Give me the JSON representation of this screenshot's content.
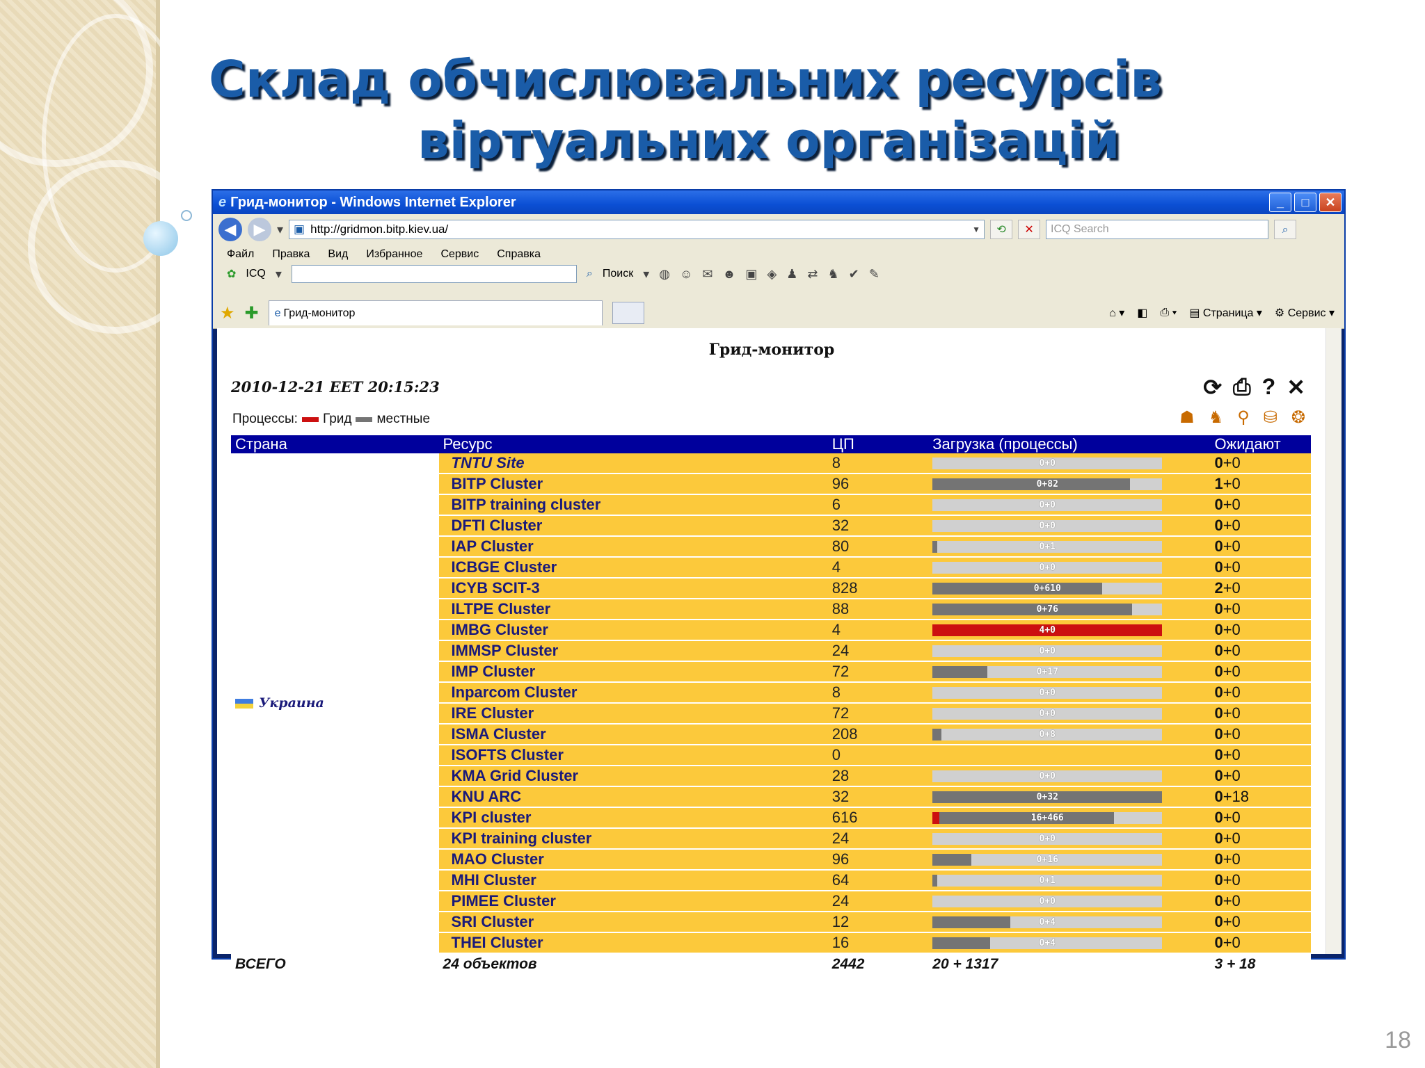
{
  "slide": {
    "title_line1": "Склад обчислювальних ресурсів",
    "title_line2": "віртуальних організацій",
    "page_number": "18"
  },
  "window": {
    "title": "Грид-монитор - Windows Internet Explorer",
    "address": "http://gridmon.bitp.kiev.ua/",
    "search_placeholder": "ICQ Search",
    "menu": [
      "Файл",
      "Правка",
      "Вид",
      "Избранное",
      "Сервис",
      "Справка"
    ],
    "toolbar_icq": "ICQ",
    "toolbar_search": "Поиск",
    "tab_label": "Грид-монитор",
    "page_menu": "Страница",
    "service_menu": "Сервис"
  },
  "page": {
    "title": "Грид-монитор",
    "datetime": "2010-12-21 EET 20:15:23",
    "legend_label": "Процессы:",
    "legend_grid": "Грид",
    "legend_local": "местные",
    "colors": {
      "grid": "#cc1010",
      "local": "#747474",
      "row": "#fcc93b",
      "header": "#00009c"
    }
  },
  "table": {
    "headers": [
      "Страна",
      "Ресурс",
      "ЦП",
      "Загрузка (процессы)",
      "Ожидают"
    ],
    "country": "Украина",
    "rows": [
      {
        "name": "TNTU Site",
        "italic": true,
        "cpu": "8",
        "load": "0+0",
        "grid_frac": 0,
        "local_frac": 0,
        "wait_a": "0",
        "wait_b": "+0"
      },
      {
        "name": "BITP Cluster",
        "cpu": "96",
        "load": "0+82",
        "grid_frac": 0,
        "local_frac": 0.86,
        "wait_a": "1",
        "wait_b": "+0"
      },
      {
        "name": "BITP training cluster",
        "cpu": "6",
        "load": "0+0",
        "grid_frac": 0,
        "local_frac": 0,
        "wait_a": "0",
        "wait_b": "+0"
      },
      {
        "name": "DFTI Cluster",
        "cpu": "32",
        "load": "0+0",
        "grid_frac": 0,
        "local_frac": 0,
        "wait_a": "0",
        "wait_b": "+0"
      },
      {
        "name": "IAP Cluster",
        "cpu": "80",
        "load": "0+1",
        "grid_frac": 0,
        "local_frac": 0.02,
        "wait_a": "0",
        "wait_b": "+0"
      },
      {
        "name": "ICBGE Cluster",
        "cpu": "4",
        "load": "0+0",
        "grid_frac": 0,
        "local_frac": 0,
        "wait_a": "0",
        "wait_b": "+0"
      },
      {
        "name": "ICYB SCIT-3",
        "cpu": "828",
        "load": "0+610",
        "grid_frac": 0,
        "local_frac": 0.74,
        "wait_a": "2",
        "wait_b": "+0"
      },
      {
        "name": "ILTPE Cluster",
        "cpu": "88",
        "load": "0+76",
        "grid_frac": 0,
        "local_frac": 0.87,
        "wait_a": "0",
        "wait_b": "+0"
      },
      {
        "name": "IMBG Cluster",
        "cpu": "4",
        "load": "4+0",
        "grid_frac": 1,
        "local_frac": 0,
        "wait_a": "0",
        "wait_b": "+0"
      },
      {
        "name": "IMMSP Cluster",
        "cpu": "24",
        "load": "0+0",
        "grid_frac": 0,
        "local_frac": 0,
        "wait_a": "0",
        "wait_b": "+0"
      },
      {
        "name": "IMP Cluster",
        "cpu": "72",
        "load": "0+17",
        "grid_frac": 0,
        "local_frac": 0.24,
        "wait_a": "0",
        "wait_b": "+0"
      },
      {
        "name": "Inparcom Cluster",
        "cpu": "8",
        "load": "0+0",
        "grid_frac": 0,
        "local_frac": 0,
        "wait_a": "0",
        "wait_b": "+0"
      },
      {
        "name": "IRE Cluster",
        "cpu": "72",
        "load": "0+0",
        "grid_frac": 0,
        "local_frac": 0,
        "wait_a": "0",
        "wait_b": "+0"
      },
      {
        "name": "ISMA Cluster",
        "cpu": "208",
        "load": "0+8",
        "grid_frac": 0,
        "local_frac": 0.04,
        "wait_a": "0",
        "wait_b": "+0"
      },
      {
        "name": "ISOFTS Cluster",
        "cpu": "0",
        "load": "",
        "grid_frac": 0,
        "local_frac": 0,
        "nobar": true,
        "wait_a": "0",
        "wait_b": "+0"
      },
      {
        "name": "KMA Grid Cluster",
        "cpu": "28",
        "load": "0+0",
        "grid_frac": 0,
        "local_frac": 0,
        "wait_a": "0",
        "wait_b": "+0"
      },
      {
        "name": "KNU ARC",
        "cpu": "32",
        "load": "0+32",
        "grid_frac": 0,
        "local_frac": 1,
        "wait_a": "0",
        "wait_b": "+18"
      },
      {
        "name": "KPI cluster",
        "cpu": "616",
        "load": "16+466",
        "grid_frac": 0.03,
        "local_frac": 0.76,
        "wait_a": "0",
        "wait_b": "+0"
      },
      {
        "name": "KPI training cluster",
        "cpu": "24",
        "load": "0+0",
        "grid_frac": 0,
        "local_frac": 0,
        "wait_a": "0",
        "wait_b": "+0"
      },
      {
        "name": "MAO Cluster",
        "cpu": "96",
        "load": "0+16",
        "grid_frac": 0,
        "local_frac": 0.17,
        "wait_a": "0",
        "wait_b": "+0"
      },
      {
        "name": "MHI Cluster",
        "cpu": "64",
        "load": "0+1",
        "grid_frac": 0,
        "local_frac": 0.02,
        "wait_a": "0",
        "wait_b": "+0"
      },
      {
        "name": "PIMEE Cluster",
        "cpu": "24",
        "load": "0+0",
        "grid_frac": 0,
        "local_frac": 0,
        "wait_a": "0",
        "wait_b": "+0"
      },
      {
        "name": "SRI Cluster",
        "cpu": "12",
        "load": "0+4",
        "grid_frac": 0,
        "local_frac": 0.34,
        "wait_a": "0",
        "wait_b": "+0"
      },
      {
        "name": "THEI Cluster",
        "cpu": "16",
        "load": "0+4",
        "grid_frac": 0,
        "local_frac": 0.25,
        "wait_a": "0",
        "wait_b": "+0"
      }
    ],
    "total": {
      "label": "ВСЕГО",
      "objects": "24 объектов",
      "cpu": "2442",
      "load": "20 + 1317",
      "wait": "3 + 18"
    }
  }
}
